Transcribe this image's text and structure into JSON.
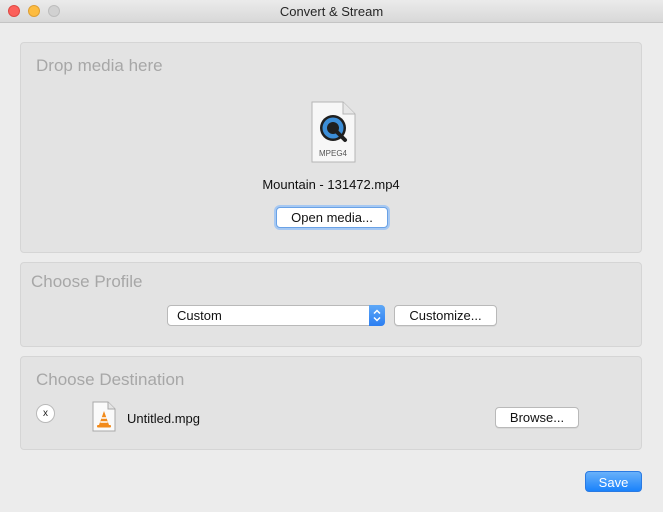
{
  "window": {
    "title": "Convert & Stream"
  },
  "source": {
    "heading": "Drop media here",
    "file_icon": "mpeg4-quicktime-file-icon",
    "file_icon_label": "MPEG4",
    "filename": "Mountain - 131472.mp4",
    "open_button_label": "Open media..."
  },
  "profile": {
    "heading": "Choose Profile",
    "selected": "Custom",
    "customize_button_label": "Customize..."
  },
  "destination": {
    "heading": "Choose Destination",
    "remove_label": "x",
    "file_icon": "vlc-cone-file-icon",
    "filename": "Untitled.mpg",
    "browse_button_label": "Browse..."
  },
  "footer": {
    "save_label": "Save"
  },
  "colors": {
    "accent": "#1a82fb",
    "close": "#fc605b",
    "minimize": "#fdbc40",
    "maximize": "#d1d1d1"
  }
}
